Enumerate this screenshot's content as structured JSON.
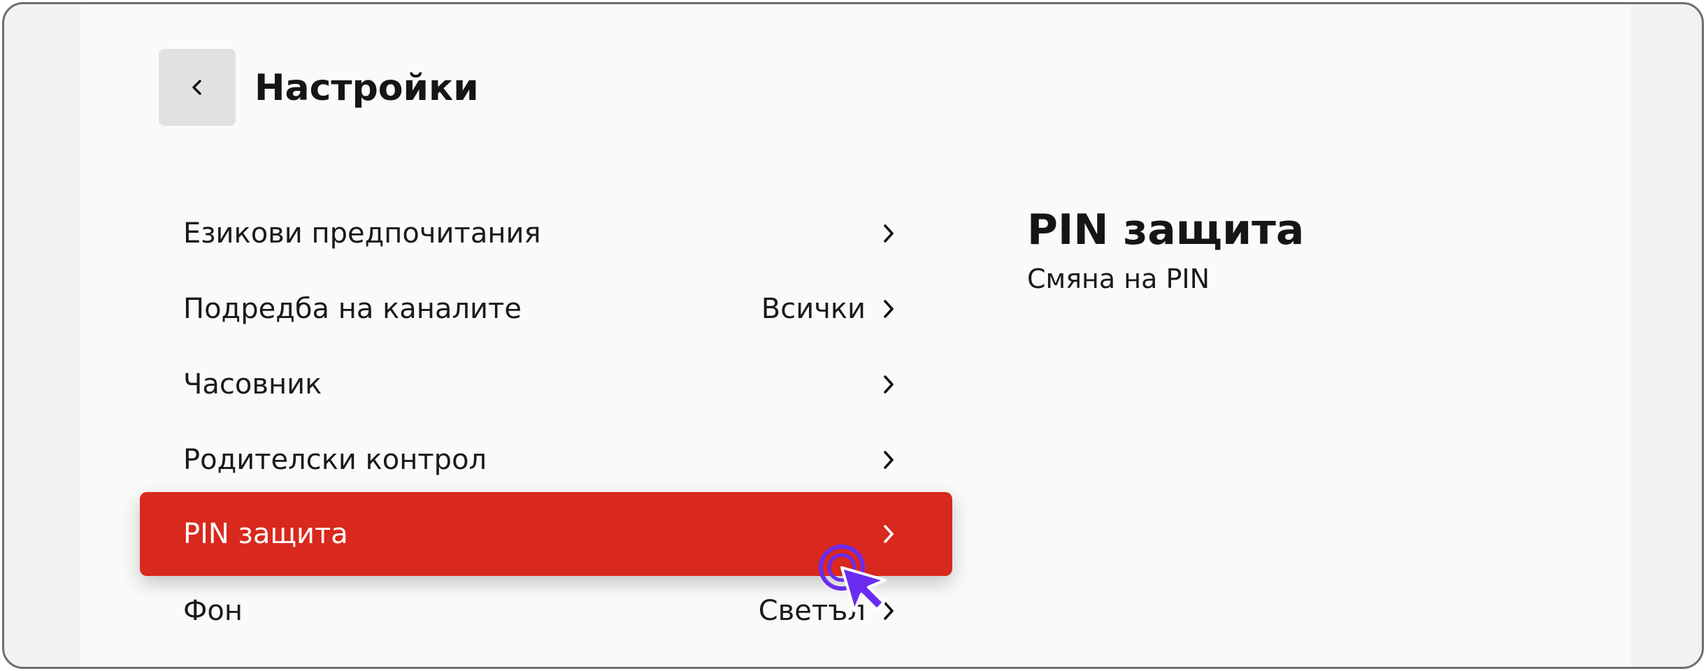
{
  "header": {
    "back_icon": "chevron-left-icon",
    "title": "Настройки"
  },
  "menu": {
    "items": [
      {
        "id": "language",
        "label": "Езикови предпочитания",
        "value": "",
        "icon": "chevron-right-icon"
      },
      {
        "id": "channel-order",
        "label": "Подредба на каналите",
        "value": "Всички",
        "icon": "chevron-right-icon"
      },
      {
        "id": "clock",
        "label": "Часовник",
        "value": "",
        "icon": "chevron-right-icon"
      },
      {
        "id": "parental-control",
        "label": "Родителски контрол",
        "value": "",
        "icon": "chevron-right-icon"
      },
      {
        "id": "pin-protection",
        "label": "PIN защита",
        "value": "",
        "icon": "chevron-right-icon",
        "selected": true
      },
      {
        "id": "background",
        "label": "Фон",
        "value": "Светъл",
        "icon": "chevron-right-icon"
      }
    ]
  },
  "detail": {
    "title": "PIN защита",
    "subtitle": "Смяна на PIN"
  },
  "colors": {
    "accent": "#d9281d",
    "cursor": "#6a2cf0",
    "panel": "#fafafa",
    "outer": "#f2f2f2"
  },
  "pointer": {
    "icon": "cursor-pointer-icon"
  }
}
